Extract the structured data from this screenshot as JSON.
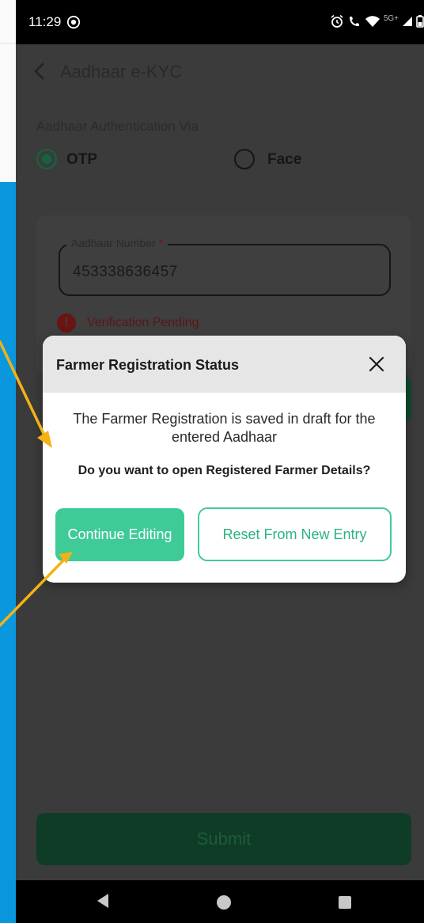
{
  "status_bar": {
    "time": "11:29",
    "network_label": "5G+"
  },
  "header": {
    "title": "Aadhaar e-KYC"
  },
  "auth": {
    "label": "Aadhaar Authentication Via",
    "options": [
      {
        "label": "OTP",
        "selected": true
      },
      {
        "label": "Face",
        "selected": false
      }
    ]
  },
  "aadhaar_field": {
    "label": "Aadhaar Number",
    "required_mark": "*",
    "value": "453338636457"
  },
  "verification": {
    "icon_glyph": "!",
    "status": "Verification Pending"
  },
  "submit": {
    "label": "Submit"
  },
  "dialog": {
    "title": "Farmer Registration Status",
    "message": "The Farmer Registration is saved in draft for the entered Aadhaar",
    "question": "Do you want to open Registered Farmer Details?",
    "continue_label": "Continue Editing",
    "reset_label": "Reset From New Entry"
  },
  "colors": {
    "accent_green": "#3ecb97",
    "annotation_arrow": "#f3b215",
    "slide_blue": "#0a97dd"
  }
}
